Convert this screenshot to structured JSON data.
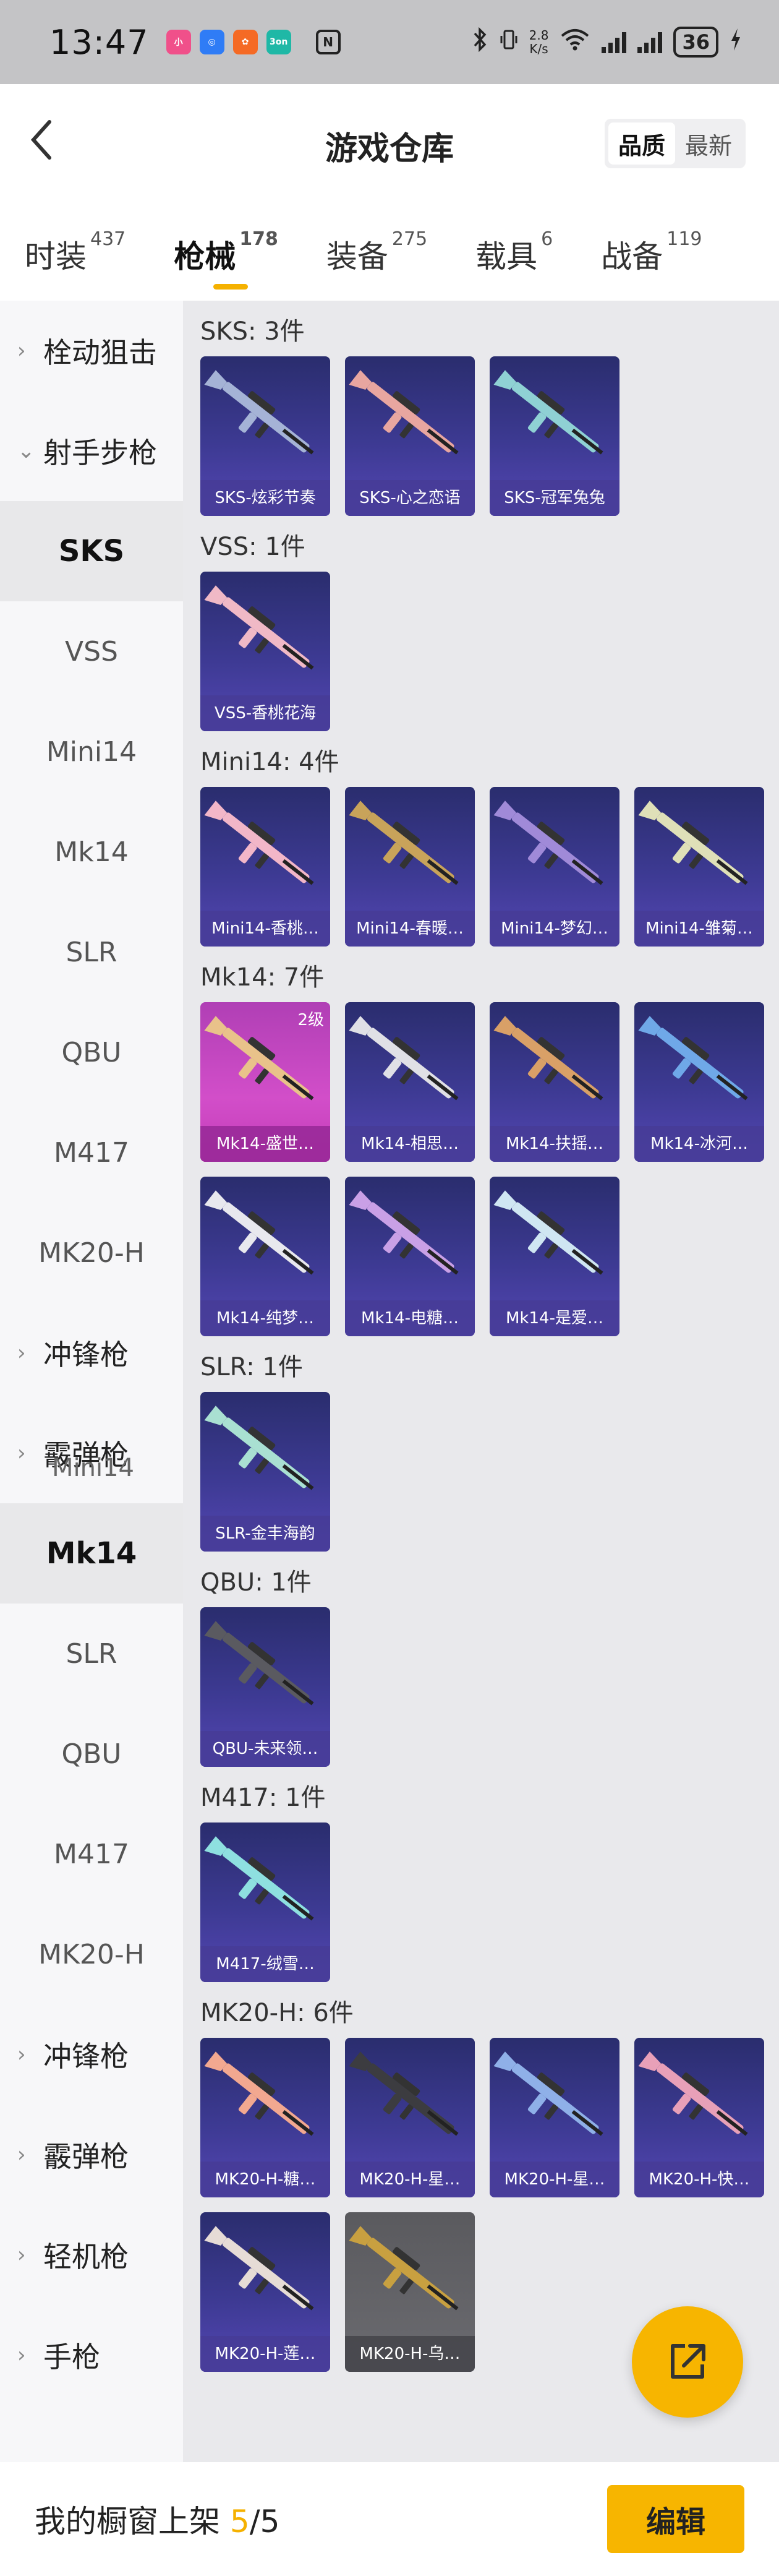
{
  "status_bar": {
    "time": "13:47",
    "net_speed_value": "2.8",
    "net_speed_unit": "K/s",
    "battery": "36",
    "apps": [
      {
        "name": "app-icon-1",
        "text": "小",
        "color": "#f0508a"
      },
      {
        "name": "app-icon-2",
        "text": "◎",
        "color": "#2f7cf6"
      },
      {
        "name": "app-icon-3",
        "text": "✿",
        "color": "#f56a25"
      },
      {
        "name": "app-icon-4",
        "text": "3on",
        "color": "#1fb8a6"
      }
    ]
  },
  "header": {
    "title": "游戏仓库",
    "sort_options": [
      "品质",
      "最新"
    ],
    "sort_active": "品质"
  },
  "tabs": [
    {
      "label": "时装",
      "count": "437"
    },
    {
      "label": "枪械",
      "count": "178"
    },
    {
      "label": "装备",
      "count": "275"
    },
    {
      "label": "载具",
      "count": "6"
    },
    {
      "label": "战备",
      "count": "119"
    }
  ],
  "sidebar": {
    "groups": [
      {
        "label": "栓动狙击",
        "chev": "›"
      },
      {
        "label": "射手步枪",
        "chev": "⌄"
      }
    ],
    "items_a": [
      "SKS",
      "VSS",
      "Mini14",
      "Mk14",
      "SLR",
      "QBU",
      "M417",
      "MK20-H"
    ],
    "groups_b": [
      {
        "label": "冲锋枪",
        "chev": "›"
      },
      {
        "label": "霰弹枪",
        "chev": "›"
      }
    ],
    "overlay_text": "Mini14",
    "items_b": [
      "Mk14",
      "SLR",
      "QBU",
      "M417",
      "MK20-H"
    ],
    "groups_c": [
      {
        "label": "冲锋枪",
        "chev": "›"
      },
      {
        "label": "霰弹枪",
        "chev": "›"
      },
      {
        "label": "轻机枪",
        "chev": "›"
      },
      {
        "label": "手枪",
        "chev": "›"
      }
    ]
  },
  "sections": [
    {
      "title": "SKS: 3件",
      "items": [
        {
          "label": "SKS-炫彩节奏",
          "style": "blue",
          "color": "#a5b3d6",
          "level": ""
        },
        {
          "label": "SKS-心之恋语",
          "style": "blue",
          "color": "#e8a6a0",
          "level": ""
        },
        {
          "label": "SKS-冠军兔兔",
          "style": "blue",
          "color": "#8fd1d4",
          "level": ""
        }
      ]
    },
    {
      "title": "VSS: 1件",
      "items": [
        {
          "label": "VSS-香桃花海",
          "style": "blue",
          "color": "#f0b9c6",
          "level": ""
        }
      ]
    },
    {
      "title": "Mini14: 4件",
      "items": [
        {
          "label": "Mini14-香桃…",
          "style": "blue",
          "color": "#f2b6c8",
          "level": ""
        },
        {
          "label": "Mini14-春暖…",
          "style": "blue",
          "color": "#c8a35a",
          "level": ""
        },
        {
          "label": "Mini14-梦幻…",
          "style": "blue",
          "color": "#a08ad8",
          "level": ""
        },
        {
          "label": "Mini14-雏菊…",
          "style": "blue",
          "color": "#dfe0b8",
          "level": ""
        }
      ]
    },
    {
      "title": "Mk14: 7件",
      "items": [
        {
          "label": "Mk14-盛世…",
          "style": "pink",
          "color": "#e9c28a",
          "level": "2级"
        },
        {
          "label": "Mk14-相思…",
          "style": "blue",
          "color": "#e0e0e6",
          "level": ""
        },
        {
          "label": "Mk14-扶摇…",
          "style": "blue",
          "color": "#d9a067",
          "level": ""
        },
        {
          "label": "Mk14-冰河…",
          "style": "blue",
          "color": "#6fa8e8",
          "level": ""
        },
        {
          "label": "Mk14-纯梦…",
          "style": "blue",
          "color": "#e8e8ee",
          "level": ""
        },
        {
          "label": "Mk14-电糖…",
          "style": "blue",
          "color": "#c9a0e6",
          "level": ""
        },
        {
          "label": "Mk14-是爱…",
          "style": "blue",
          "color": "#cfe6f2",
          "level": ""
        }
      ]
    },
    {
      "title": "SLR: 1件",
      "items": [
        {
          "label": "SLR-金丰海韵",
          "style": "blue",
          "color": "#a9e0d2",
          "level": ""
        }
      ]
    },
    {
      "title": "QBU: 1件",
      "items": [
        {
          "label": "QBU-未来领…",
          "style": "blue",
          "color": "#5a5a60",
          "level": ""
        }
      ]
    },
    {
      "title": "M417: 1件",
      "items": [
        {
          "label": "M417-绒雪…",
          "style": "blue",
          "color": "#8ee0e0",
          "level": ""
        }
      ]
    },
    {
      "title": "MK20-H: 6件",
      "items": [
        {
          "label": "MK20-H-糖…",
          "style": "blue",
          "color": "#f2a890",
          "level": ""
        },
        {
          "label": "MK20-H-星…",
          "style": "blue",
          "color": "#3c3c40",
          "level": ""
        },
        {
          "label": "MK20-H-星…",
          "style": "blue",
          "color": "#8fb0e8",
          "level": ""
        },
        {
          "label": "MK20-H-快…",
          "style": "blue",
          "color": "#e8a0b8",
          "level": ""
        },
        {
          "label": "MK20-H-莲…",
          "style": "blue",
          "color": "#e6dcd6",
          "level": ""
        },
        {
          "label": "MK20-H-乌…",
          "style": "gray",
          "color": "#c8a040",
          "level": ""
        }
      ]
    }
  ],
  "bottom_bar": {
    "prefix": "我的橱窗上架 ",
    "count": "5",
    "total": "/5",
    "edit_label": "编辑"
  },
  "colors": {
    "accent": "#f7b500"
  }
}
